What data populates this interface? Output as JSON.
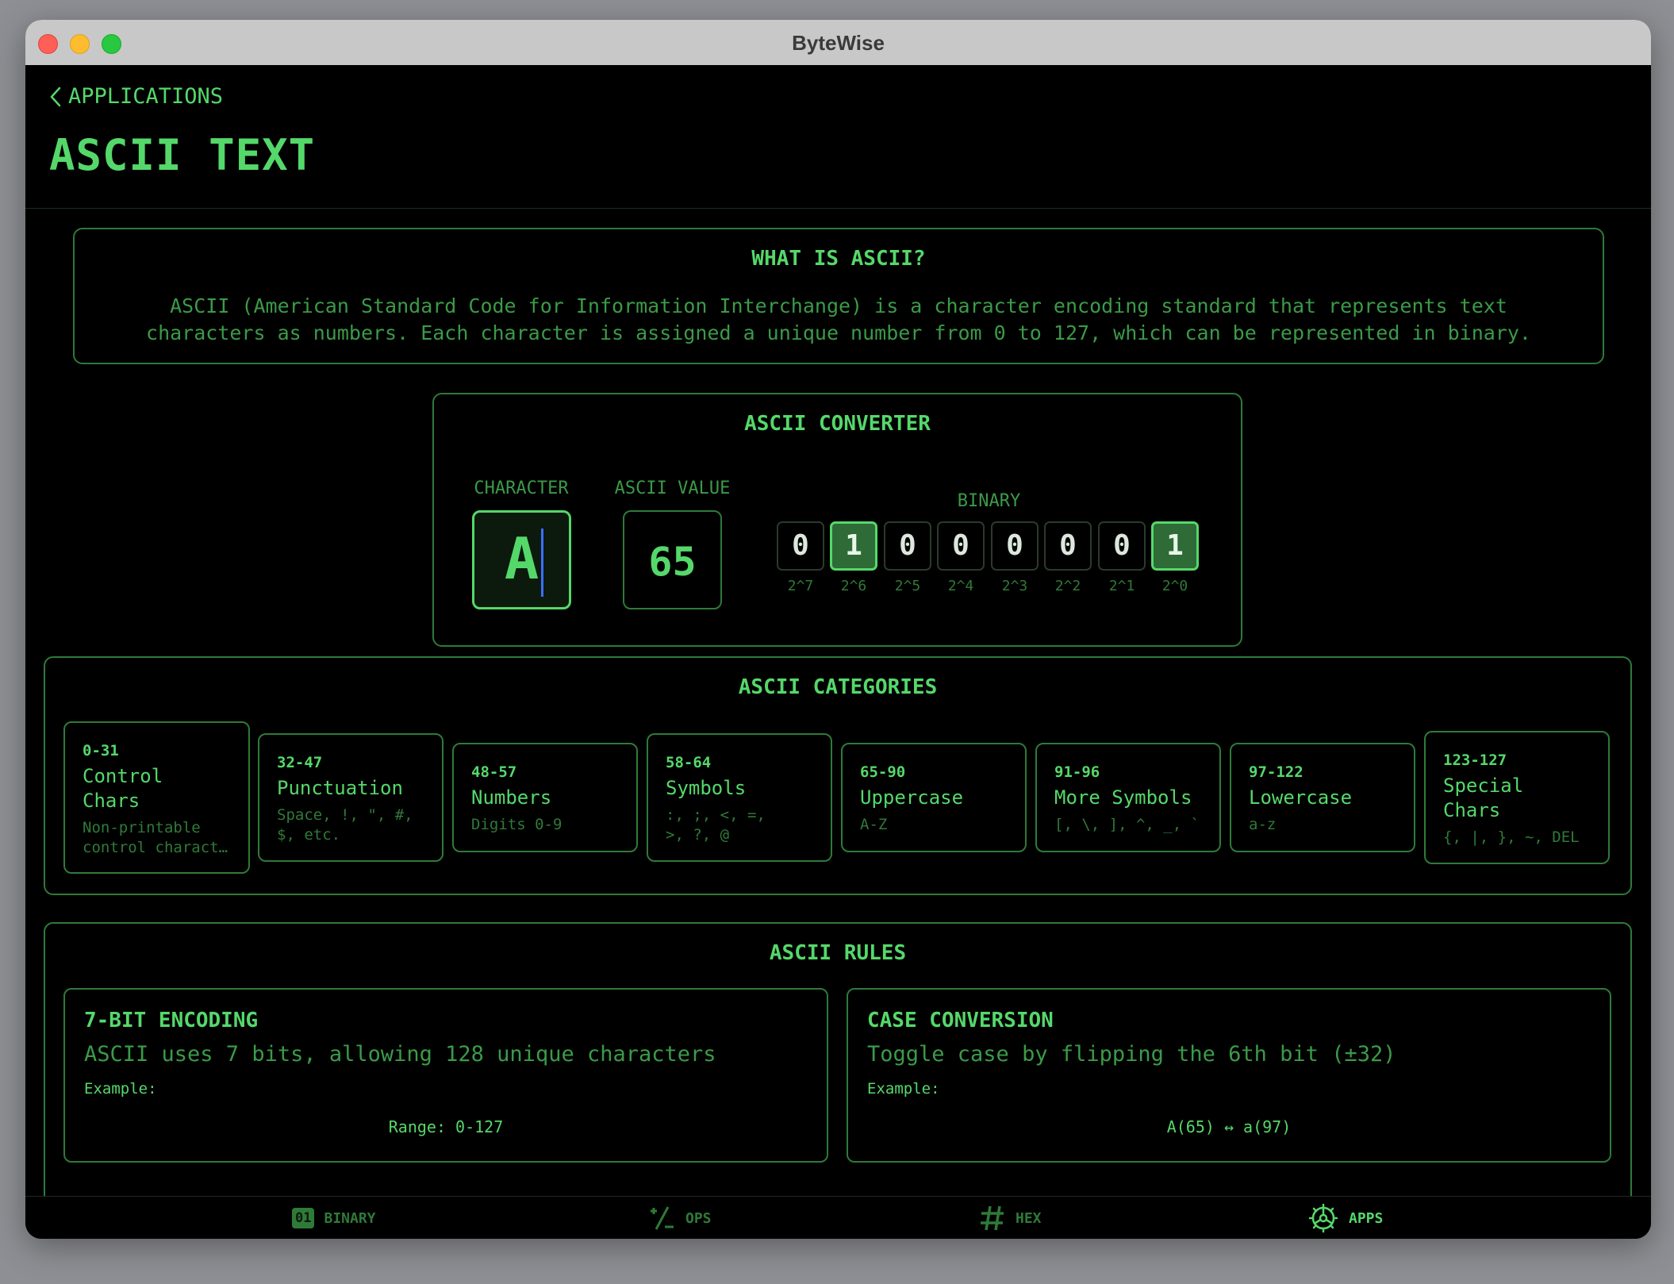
{
  "window": {
    "title": "ByteWise"
  },
  "nav": {
    "back_label": "APPLICATIONS",
    "page_title": "ASCII TEXT"
  },
  "what_is": {
    "title": "WHAT IS ASCII?",
    "line1": "ASCII (American Standard Code for Information Interchange) is a character encoding standard that represents text",
    "line2": "characters as numbers. Each character is assigned a unique number from 0 to 127, which can be represented in binary."
  },
  "converter": {
    "title": "ASCII CONVERTER",
    "character_label": "CHARACTER",
    "character_value": "A",
    "ascii_label": "ASCII VALUE",
    "ascii_value": "65",
    "binary_label": "BINARY",
    "bits": [
      "0",
      "1",
      "0",
      "0",
      "0",
      "0",
      "0",
      "1"
    ],
    "powers": [
      "2^7",
      "2^6",
      "2^5",
      "2^4",
      "2^3",
      "2^2",
      "2^1",
      "2^0"
    ]
  },
  "categories": {
    "title": "ASCII CATEGORIES",
    "items": [
      {
        "range": "0-31",
        "name_l1": "Control",
        "name_l2": "Chars",
        "desc_l1": "Non-printable",
        "desc_l2": "control charact…"
      },
      {
        "range": "32-47",
        "name_l1": "Punctuation",
        "name_l2": "",
        "desc_l1": "Space, !, \", #,",
        "desc_l2": "$, etc."
      },
      {
        "range": "48-57",
        "name_l1": "Numbers",
        "name_l2": "",
        "desc_l1": "Digits 0-9",
        "desc_l2": ""
      },
      {
        "range": "58-64",
        "name_l1": "Symbols",
        "name_l2": "",
        "desc_l1": ":, ;, <, =,",
        "desc_l2": ">, ?, @"
      },
      {
        "range": "65-90",
        "name_l1": "Uppercase",
        "name_l2": "",
        "desc_l1": "A-Z",
        "desc_l2": ""
      },
      {
        "range": "91-96",
        "name_l1": "More Symbols",
        "name_l2": "",
        "desc_l1": "[, \\, ], ^, _, `",
        "desc_l2": ""
      },
      {
        "range": "97-122",
        "name_l1": "Lowercase",
        "name_l2": "",
        "desc_l1": "a-z",
        "desc_l2": ""
      },
      {
        "range": "123-127",
        "name_l1": "Special",
        "name_l2": "Chars",
        "desc_l1": "{, |, }, ~, DEL",
        "desc_l2": ""
      }
    ]
  },
  "rules": {
    "title": "ASCII RULES",
    "items": [
      {
        "title": "7-BIT ENCODING",
        "subtitle": "ASCII uses 7 bits, allowing 128 unique characters",
        "example_label": "Example:",
        "example": "Range: 0-127"
      },
      {
        "title": "CASE CONVERSION",
        "subtitle": "Toggle case by flipping the 6th bit (±32)",
        "example_label": "Example:",
        "example": "A(65) ↔ a(97)"
      }
    ]
  },
  "tabbar": {
    "binary_badge": "01",
    "binary": "BINARY",
    "ops": "OPS",
    "hex": "HEX",
    "apps": "APPS",
    "active": "apps"
  },
  "colors": {
    "accent": "#55d86a",
    "border": "#2f7a38",
    "muted": "#3b9a48",
    "background": "#000000",
    "caret": "#3b6eff"
  }
}
